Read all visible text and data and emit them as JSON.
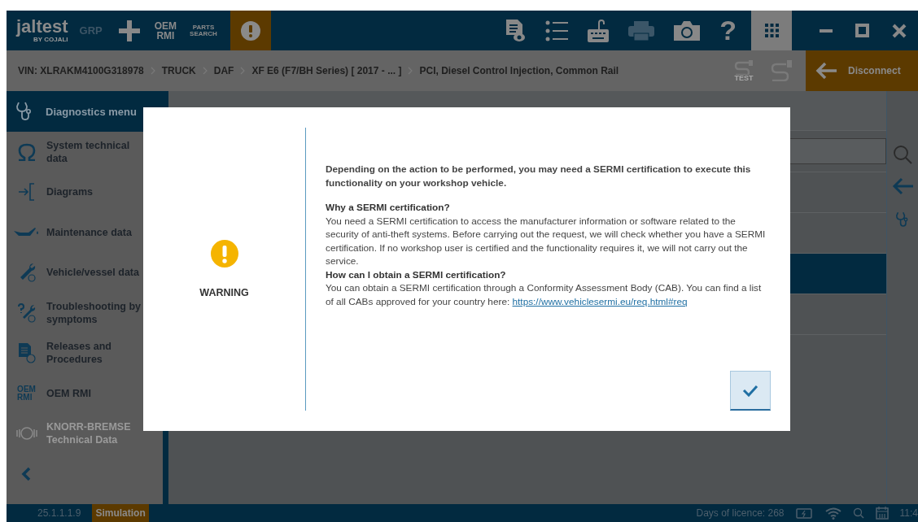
{
  "toolbar": {
    "logo": "jaltest",
    "logo_sub": "BY COJALI",
    "grp": "GRP",
    "oem_rmi": [
      "OEM",
      "RMI"
    ],
    "parts_search": [
      "PARTS",
      "SEARCH"
    ],
    "help": "?"
  },
  "breadcrumb": {
    "items": [
      "VIN: XLRAKM4100G318978",
      "TRUCK",
      "DAF",
      "XF E6 (F7/BH Series) [ 2017 - ... ]",
      "PCI, Diesel Control Injection, Common Rail"
    ],
    "test_label": "TEST",
    "disconnect": "Disconnect"
  },
  "sidebar": {
    "header": "Diagnostics menu",
    "items": [
      {
        "label": "System technical data",
        "disabled": false
      },
      {
        "label": "Diagrams",
        "disabled": false
      },
      {
        "label": "Maintenance data",
        "disabled": false
      },
      {
        "label": "Vehicle/vessel data",
        "disabled": false
      },
      {
        "label": "Troubleshooting by symptoms",
        "disabled": false
      },
      {
        "label": "Releases and Procedures",
        "disabled": false
      },
      {
        "label": "OEM RMI",
        "disabled": false,
        "logo": [
          "OEM",
          "RMI"
        ]
      },
      {
        "label": "KNORR-BREMSE Technical Data",
        "disabled": true
      }
    ]
  },
  "main_list": [
    {
      "selected": false
    },
    {
      "selected": false
    },
    {
      "selected": true
    },
    {
      "selected": false
    }
  ],
  "modal": {
    "title": "WARNING",
    "lead": "Depending on the action to be performed, you may need a SERMI certification to execute this functionality on your workshop vehicle.",
    "sections": [
      {
        "heading": "Why a SERMI certification?",
        "body": "You need a SERMI certification to access the manufacturer information or software related to the security of anti-theft systems. Before carrying out the request, we will check whether you have a SERMI certification. If no workshop user is certified and the functionality requires it, we will not carry out the service."
      },
      {
        "heading": "How can I obtain a SERMI certification?",
        "body": "You can obtain a SERMI certification through a Conformity Assessment Body (CAB). You can find a list of all CABs approved for your country here:",
        "link": "https://www.vehiclesermi.eu/req.html#req"
      }
    ]
  },
  "status_bar": {
    "version": "25.1.1.1.9",
    "mode": "Simulation",
    "licence": "Days of licence: 268",
    "time": "11:4"
  }
}
